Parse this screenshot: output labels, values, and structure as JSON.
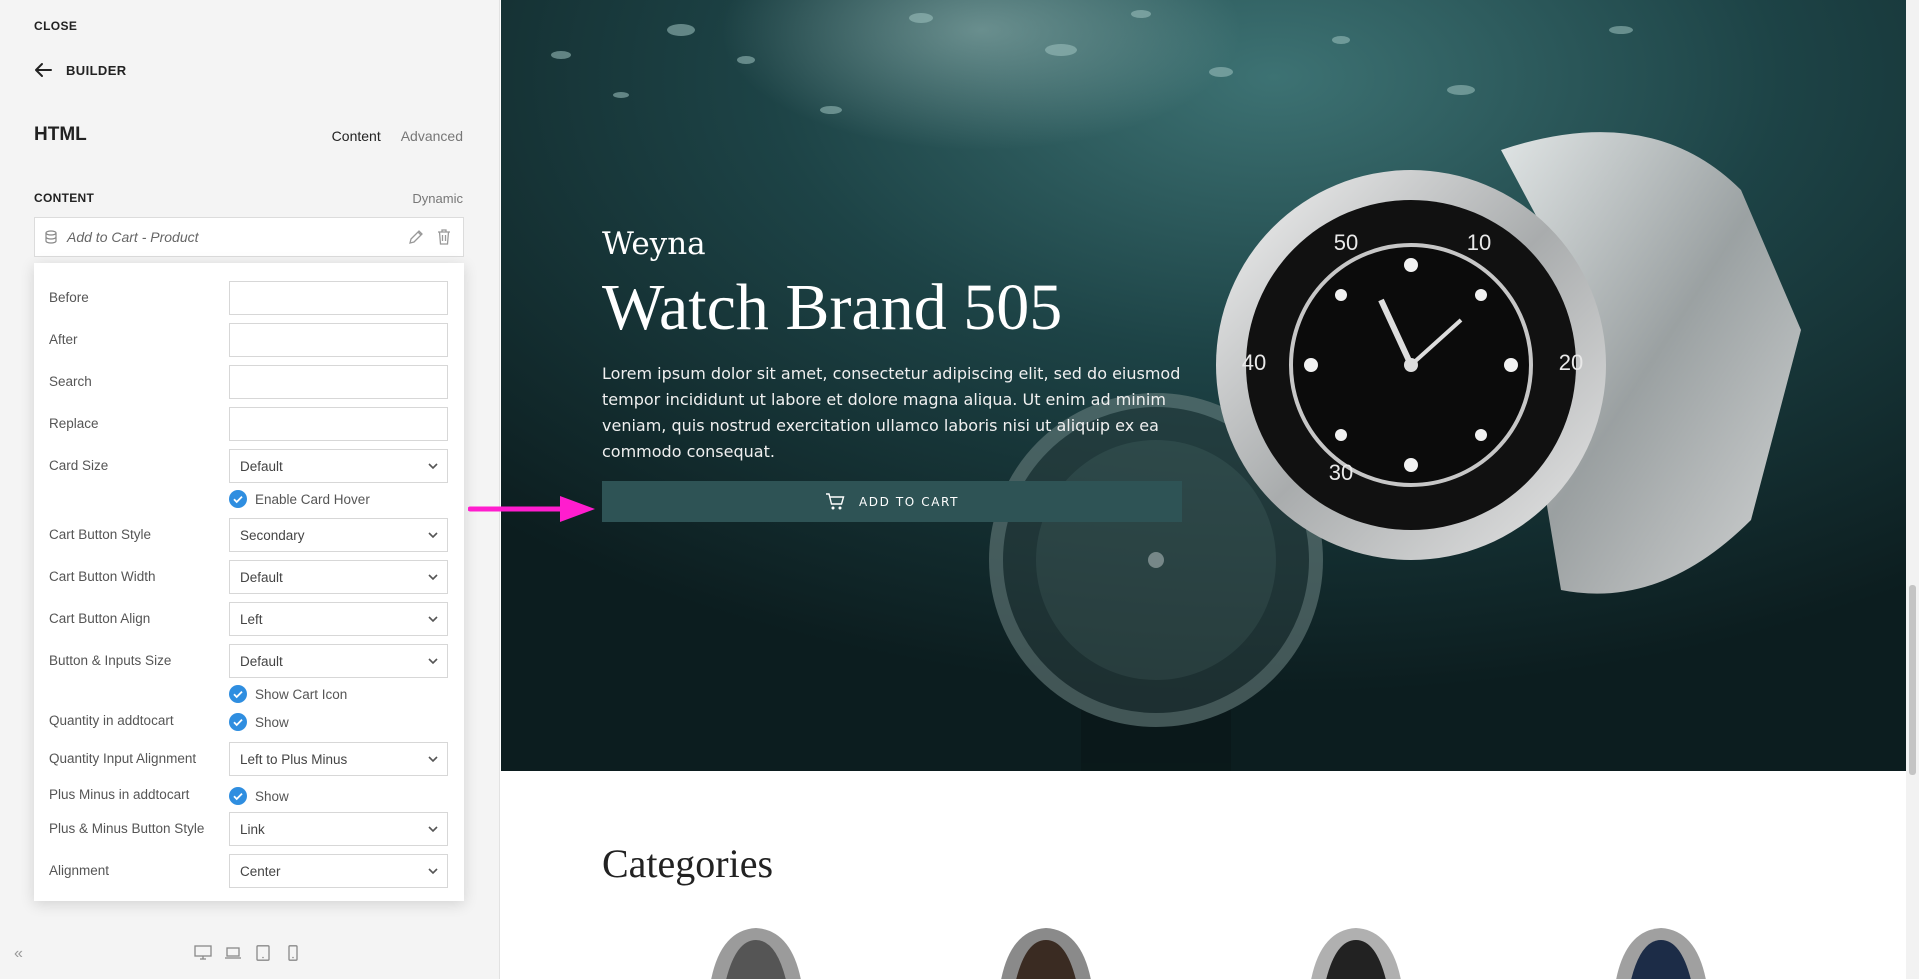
{
  "panel": {
    "close_label": "CLOSE",
    "back_label": "BUILDER",
    "element_title": "HTML",
    "tabs": [
      {
        "label": "Content",
        "active": true
      },
      {
        "label": "Advanced",
        "active": false
      }
    ],
    "section_label": "CONTENT",
    "dynamic_label": "Dynamic",
    "dynamic_tag": {
      "icon": "database-icon",
      "text": "Add to Cart - Product"
    },
    "fields": {
      "before": {
        "label": "Before",
        "value": ""
      },
      "after": {
        "label": "After",
        "value": ""
      },
      "search": {
        "label": "Search",
        "value": ""
      },
      "replace": {
        "label": "Replace",
        "value": ""
      },
      "card_size": {
        "label": "Card Size",
        "value": "Default"
      },
      "enable_card_hover": {
        "label": "Enable Card Hover",
        "checked": true
      },
      "cart_button_style": {
        "label": "Cart Button Style",
        "value": "Secondary"
      },
      "cart_button_width": {
        "label": "Cart Button Width",
        "value": "Default"
      },
      "cart_button_align": {
        "label": "Cart Button Align",
        "value": "Left"
      },
      "button_inputs_size": {
        "label": "Button & Inputs Size",
        "value": "Default"
      },
      "show_cart_icon": {
        "label": "Show Cart Icon",
        "checked": true
      },
      "quantity_in_addtocart": {
        "label": "Quantity in addtocart",
        "check_label": "Show",
        "checked": true
      },
      "quantity_input_alignment": {
        "label": "Quantity Input Alignment",
        "value": "Left to Plus Minus"
      },
      "plus_minus_in_addtocart": {
        "label": "Plus Minus in addtocart",
        "check_label": "Show",
        "checked": true
      },
      "plus_minus_button_style": {
        "label": "Plus & Minus Button Style",
        "value": "Link"
      },
      "alignment": {
        "label": "Alignment",
        "value": "Center"
      }
    },
    "collapse_icon": "double-chevron-left-icon",
    "devices": [
      "desktop-icon",
      "laptop-icon",
      "tablet-icon",
      "mobile-icon"
    ]
  },
  "hero": {
    "brand": "Weyna",
    "title": "Watch Brand 505",
    "description": "Lorem ipsum dolor sit amet, consectetur adipiscing elit, sed do eiusmod tempor incididunt ut labore et dolore magna aliqua. Ut enim ad minim veniam, quis nostrud exercitation ullamco laboris nisi ut aliquip ex ea commodo consequat.",
    "cart_button": {
      "icon": "cart-icon",
      "label": "ADD TO CART"
    }
  },
  "categories": {
    "title": "Categories"
  },
  "colors": {
    "accent_check": "#2f8ee0",
    "cart_button_bg": "#2e5355",
    "annotation_arrow": "#ff1dce",
    "hero_bg": "#163033"
  }
}
